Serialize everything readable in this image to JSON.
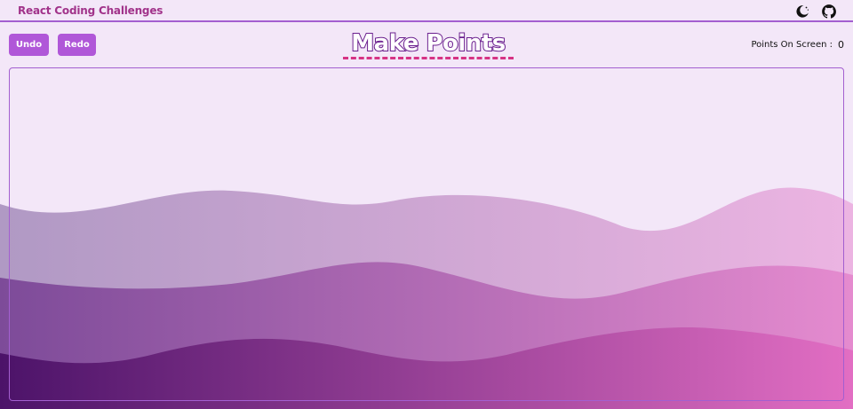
{
  "header": {
    "brand": "React Coding Challenges",
    "icons": [
      "moon-icon",
      "github-icon"
    ]
  },
  "toolbar": {
    "undo_label": "Undo",
    "redo_label": "Redo"
  },
  "page": {
    "title": "Make Points",
    "points_label": "Points On Screen :",
    "points_value": "0"
  },
  "colors": {
    "accent": "#b057d8",
    "brand_text": "#a1338a",
    "title_underline": "#d63384",
    "background": "#f3e7f8"
  }
}
